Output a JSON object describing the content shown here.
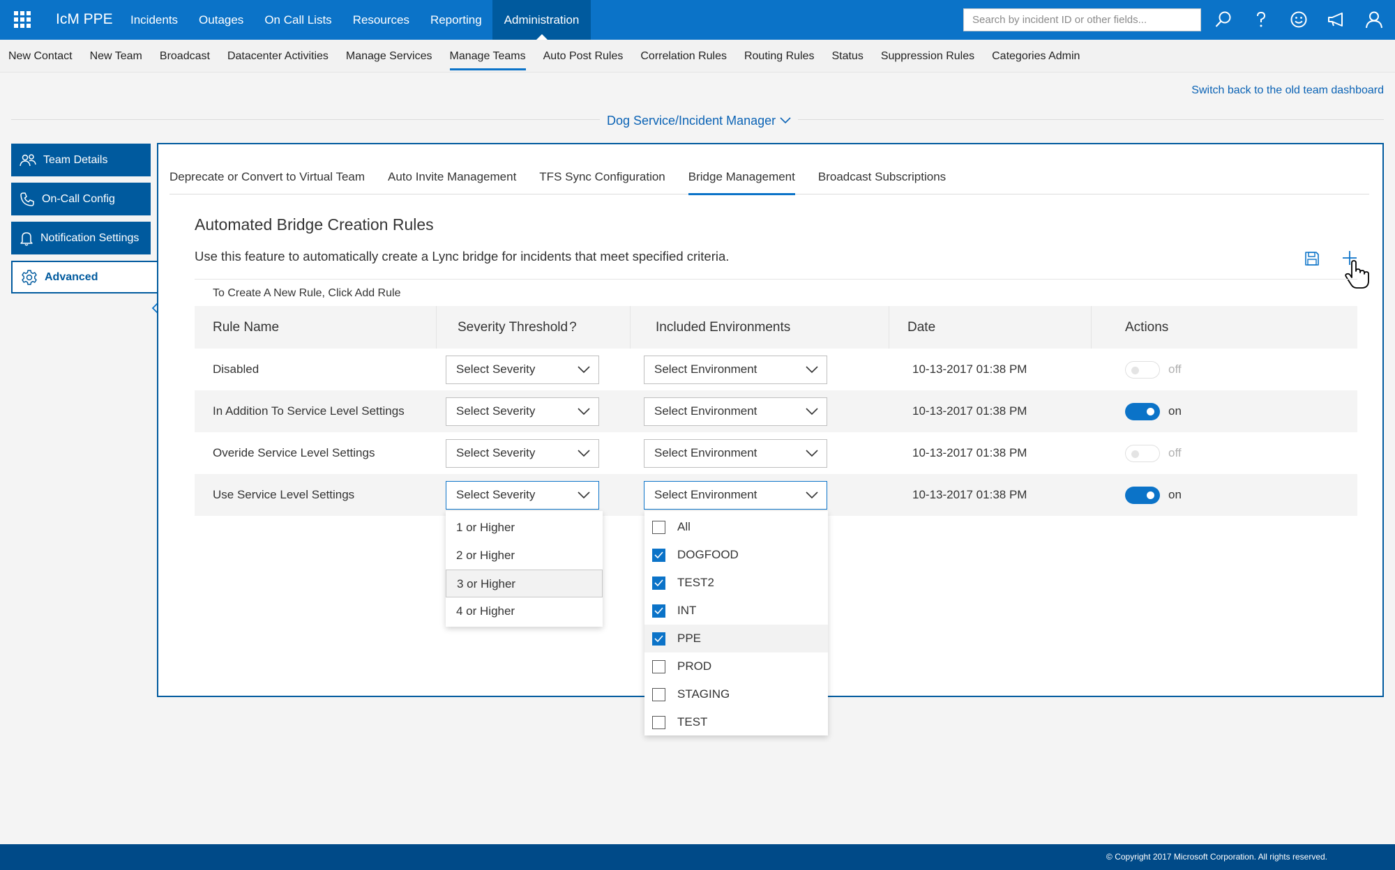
{
  "app": {
    "brand": "IcM PPE"
  },
  "top_nav": [
    "Incidents",
    "Outages",
    "On Call Lists",
    "Resources",
    "Reporting",
    "Administration"
  ],
  "search": {
    "placeholder": "Search by incident ID or other fields..."
  },
  "sub_nav": [
    "New Contact",
    "New Team",
    "Broadcast",
    "Datacenter Activities",
    "Manage Services",
    "Manage Teams",
    "Auto Post Rules",
    "Correlation Rules",
    "Routing Rules",
    "Status",
    "Suppression Rules",
    "Categories Admin"
  ],
  "switch_link": "Switch back to the old team dashboard",
  "team_selector": "Dog Service/Incident Manager",
  "side_nav": [
    {
      "label": "Team Details",
      "icon": "team-icon"
    },
    {
      "label": "On-Call Config",
      "icon": "phone-icon"
    },
    {
      "label": "Notification Settings",
      "icon": "bell-icon"
    },
    {
      "label": "Advanced",
      "icon": "gear-icon"
    }
  ],
  "tabs": [
    "Deprecate or Convert to Virtual Team",
    "Auto Invite Management",
    "TFS Sync Configuration",
    "Bridge Management",
    "Broadcast Subscriptions"
  ],
  "section": {
    "title": "Automated Bridge Creation Rules",
    "description": "Use this feature to automatically create a Lync bridge for incidents that meet specified criteria.",
    "hint": "To Create A New Rule, Click Add Rule"
  },
  "table": {
    "headers": [
      "Rule Name",
      "Severity Threshold",
      "Included Environments",
      "Date",
      "Actions"
    ],
    "help_mark": "?",
    "rows": [
      {
        "name": "Disabled",
        "severity": "Select Severity",
        "environment": "Select Environment",
        "date": "10-13-2017 01:38 PM",
        "toggle": "off"
      },
      {
        "name": "In Addition To Service Level Settings",
        "severity": "Select Severity",
        "environment": "Select Environment",
        "date": "10-13-2017 01:38 PM",
        "toggle": "on"
      },
      {
        "name": "Overide Service Level Settings",
        "severity": "Select Severity",
        "environment": "Select Environment",
        "date": "10-13-2017 01:38 PM",
        "toggle": "off"
      },
      {
        "name": "Use Service Level Settings",
        "severity": "Select Severity",
        "environment": "Select Environment",
        "date": "10-13-2017 01:38 PM",
        "toggle": "on"
      }
    ]
  },
  "severity_options": [
    "1 or Higher",
    "2 or Higher",
    "3 or Higher",
    "4 or Higher"
  ],
  "environment_options": [
    {
      "label": "All",
      "checked": false
    },
    {
      "label": "DOGFOOD",
      "checked": true
    },
    {
      "label": "TEST2",
      "checked": true
    },
    {
      "label": "INT",
      "checked": true
    },
    {
      "label": "PPE",
      "checked": true
    },
    {
      "label": "PROD",
      "checked": false
    },
    {
      "label": "STAGING",
      "checked": false
    },
    {
      "label": "TEST",
      "checked": false
    }
  ],
  "footer": "© Copyright 2017 Microsoft Corporation. All rights reserved.",
  "colors": {
    "primary": "#0b73c8",
    "dark": "#005a9e",
    "footer": "#004a88"
  }
}
